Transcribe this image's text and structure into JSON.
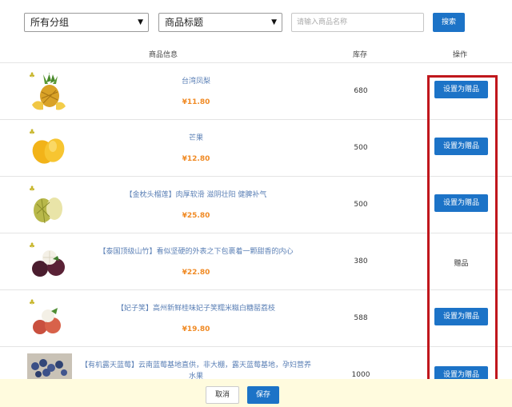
{
  "filters": {
    "group_select": "所有分组",
    "field_select": "商品标题",
    "search_placeholder": "请输入商品名称",
    "search_button": "搜索"
  },
  "table": {
    "headers": {
      "info": "商品信息",
      "stock": "库存",
      "action": "操作"
    },
    "rows": [
      {
        "title": "台湾凤梨",
        "price": "¥11.80",
        "stock": "680",
        "action": "设置为赠品",
        "action_type": "button",
        "image": "pineapple"
      },
      {
        "title": "芒果",
        "price": "¥12.80",
        "stock": "500",
        "action": "设置为赠品",
        "action_type": "button",
        "image": "mango"
      },
      {
        "title": "【金枕头榴莲】肉厚软滑 滋阴壮阳 健脾补气",
        "price": "¥25.80",
        "stock": "500",
        "action": "设置为赠品",
        "action_type": "button",
        "image": "durian"
      },
      {
        "title": "【泰国顶级山竹】看似坚硬的外表之下包裹着一颗甜香的内心",
        "price": "¥22.80",
        "stock": "380",
        "action": "赠品",
        "action_type": "text",
        "image": "mangosteen"
      },
      {
        "title": "【妃子笑】高州新鲜桂味妃子笑糯米糍白糖罂荔枝",
        "price": "¥19.80",
        "stock": "588",
        "action": "设置为赠品",
        "action_type": "button",
        "image": "lychee"
      },
      {
        "title": "【有机露天蓝莓】云南蓝莓基地直供，非大棚，露天蓝莓基地，孕妇营养水果",
        "price": "",
        "stock": "1000",
        "action": "设置为赠品",
        "action_type": "button",
        "image": "blueberry"
      }
    ]
  },
  "footer": {
    "cancel": "取消",
    "save": "保存"
  },
  "colors": {
    "primary": "#1c73c7",
    "price": "#f08a24",
    "highlight": "#c0171c",
    "footer_bg": "#fffbde"
  }
}
